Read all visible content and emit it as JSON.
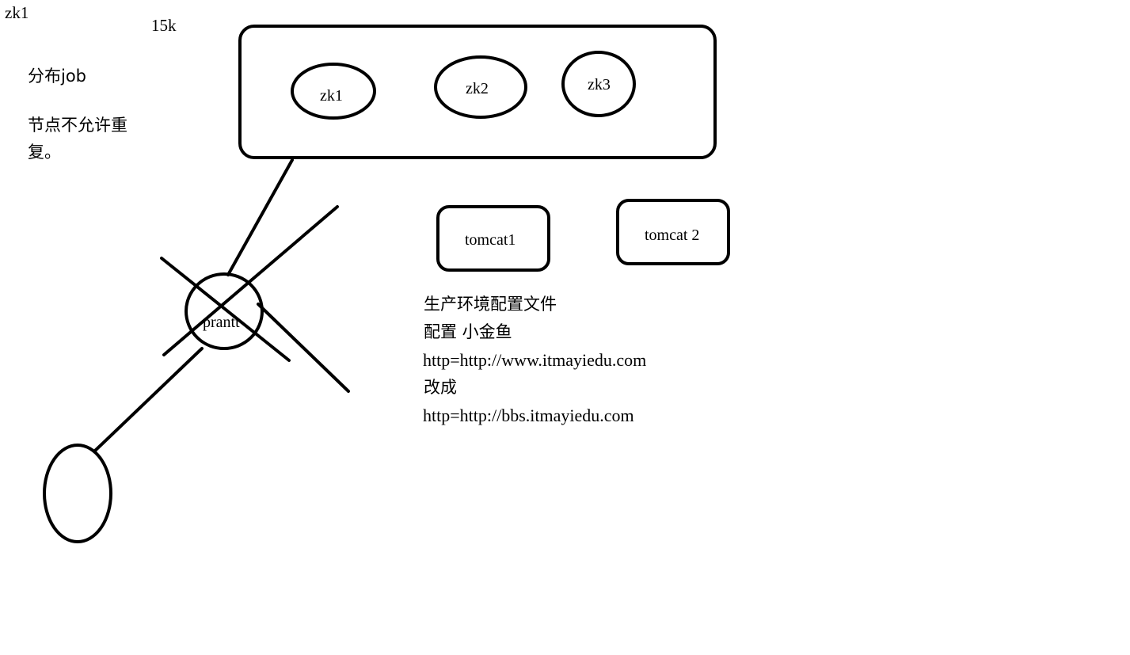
{
  "canvas": {
    "background": "#ffffff",
    "stroke_color": "#000000"
  },
  "corner_labels": {
    "top_left": "zk1",
    "top": "15k"
  },
  "notes_left": {
    "line1": "分布job",
    "line2": "节点不允许重",
    "line3": "复。"
  },
  "zookeeper_cluster": {
    "nodes": [
      "zk1",
      "zk2",
      "zk3"
    ]
  },
  "tomcats": [
    "tomcat1",
    "tomcat 2"
  ],
  "crossed_node": {
    "label": "prantt"
  },
  "notes_right": {
    "line1": "生产环境配置文件",
    "line2": "配置 小金鱼",
    "line3": "http=http://www.itmayiedu.com",
    "line4": "改成",
    "line5": "http=http://bbs.itmayiedu.com"
  }
}
